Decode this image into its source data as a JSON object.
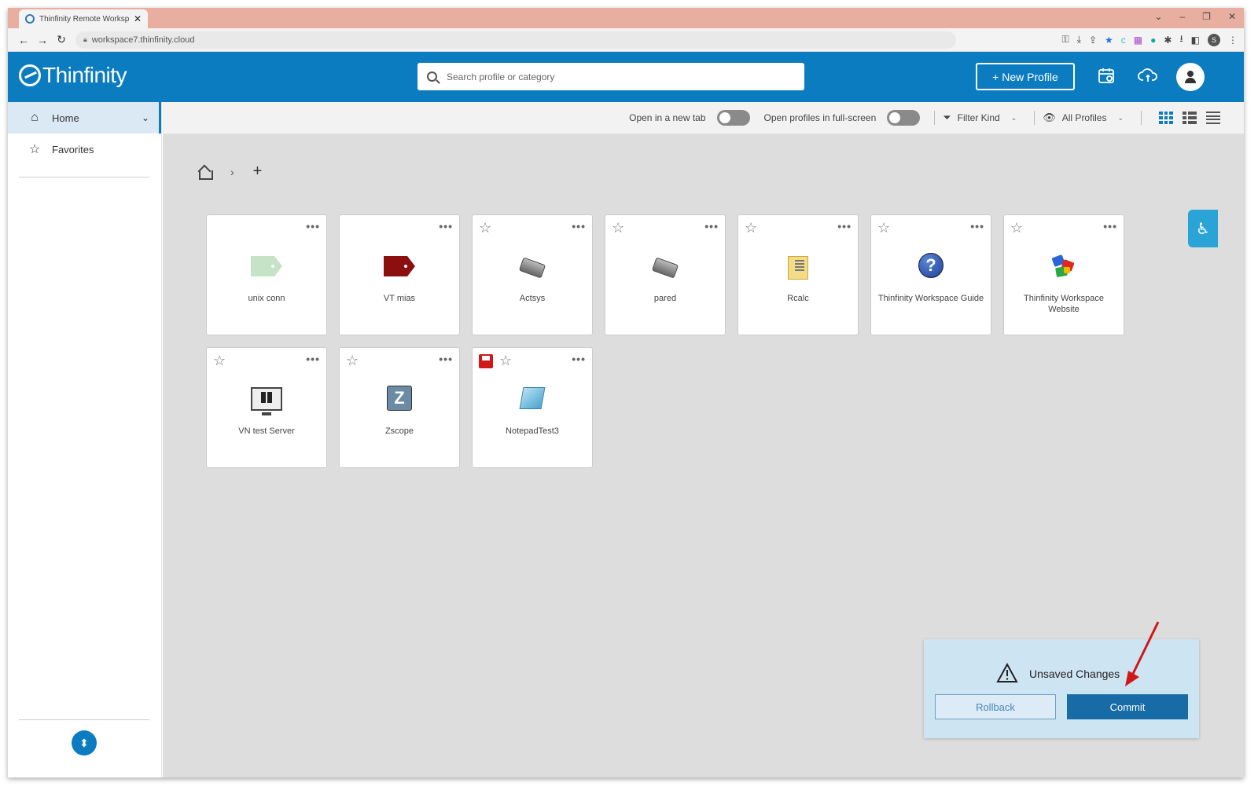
{
  "browser": {
    "tab_title": "Thinfinity Remote Worksp",
    "url": "workspace7.thinfinity.cloud",
    "profile_initial": "S"
  },
  "header": {
    "logo_text": "Thinfinity",
    "search_placeholder": "Search profile or category",
    "new_profile_label": "+ New Profile"
  },
  "sidebar": {
    "items": [
      {
        "label": "Home",
        "icon": "home-icon",
        "active": true
      },
      {
        "label": "Favorites",
        "icon": "star-icon",
        "active": false
      }
    ]
  },
  "toolbar": {
    "open_new_tab_label": "Open in a new tab",
    "open_new_tab_on": false,
    "fullscreen_label": "Open profiles in full-screen",
    "fullscreen_on": false,
    "filter_label": "Filter Kind",
    "profiles_label": "All Profiles"
  },
  "breadcrumb": {
    "separator": "›",
    "add": "+"
  },
  "cards": [
    {
      "label": "unix conn",
      "icon": "tag-green-icon",
      "star": false
    },
    {
      "label": "VT mias",
      "icon": "tag-red-icon",
      "star": false
    },
    {
      "label": "Actsys",
      "icon": "chip-icon",
      "star": true
    },
    {
      "label": "pared",
      "icon": "chip-icon",
      "star": true
    },
    {
      "label": "Rcalc",
      "icon": "calculator-icon",
      "star": true
    },
    {
      "label": "Thinfinity Workspace Guide",
      "icon": "help-icon",
      "star": true
    },
    {
      "label": "Thinfinity Workspace Website",
      "icon": "pinwheel-icon",
      "star": true
    },
    {
      "label": "VN test Server",
      "icon": "monitor-icon",
      "star": true
    },
    {
      "label": "Zscope",
      "icon": "zscope-icon",
      "star": true
    },
    {
      "label": "NotepadTest3",
      "icon": "notepad-icon",
      "star": true,
      "unsaved": true
    }
  ],
  "unsaved_panel": {
    "title": "Unsaved Changes",
    "rollback_label": "Rollback",
    "commit_label": "Commit"
  },
  "colors": {
    "brand": "#0c7cc1",
    "tabstrip": "#e8afa0",
    "content_bg": "#dddddd",
    "commit": "#176ba6",
    "annotation_arrow": "#d01818"
  }
}
